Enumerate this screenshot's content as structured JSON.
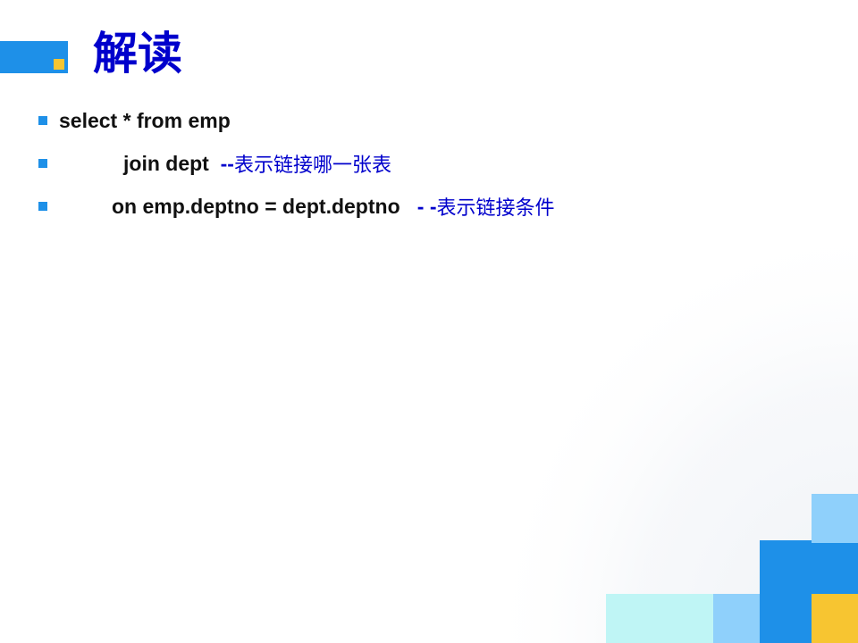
{
  "slide": {
    "title": "解读",
    "lines": [
      {
        "code": "select * from emp",
        "comment_dash": "",
        "comment_text": ""
      },
      {
        "code": "join dept  ",
        "comment_dash": "--",
        "comment_text": "表示链接哪一张表"
      },
      {
        "code": "on emp.deptno = dept.deptno   ",
        "comment_dash": "- -",
        "comment_text": "表示链接条件"
      }
    ]
  },
  "colors": {
    "accent_blue": "#1e90e8",
    "accent_yellow": "#f7c531",
    "title_blue": "#0000cc",
    "light_cyan": "#bff5f5",
    "light_blue": "#8fd0fb"
  }
}
